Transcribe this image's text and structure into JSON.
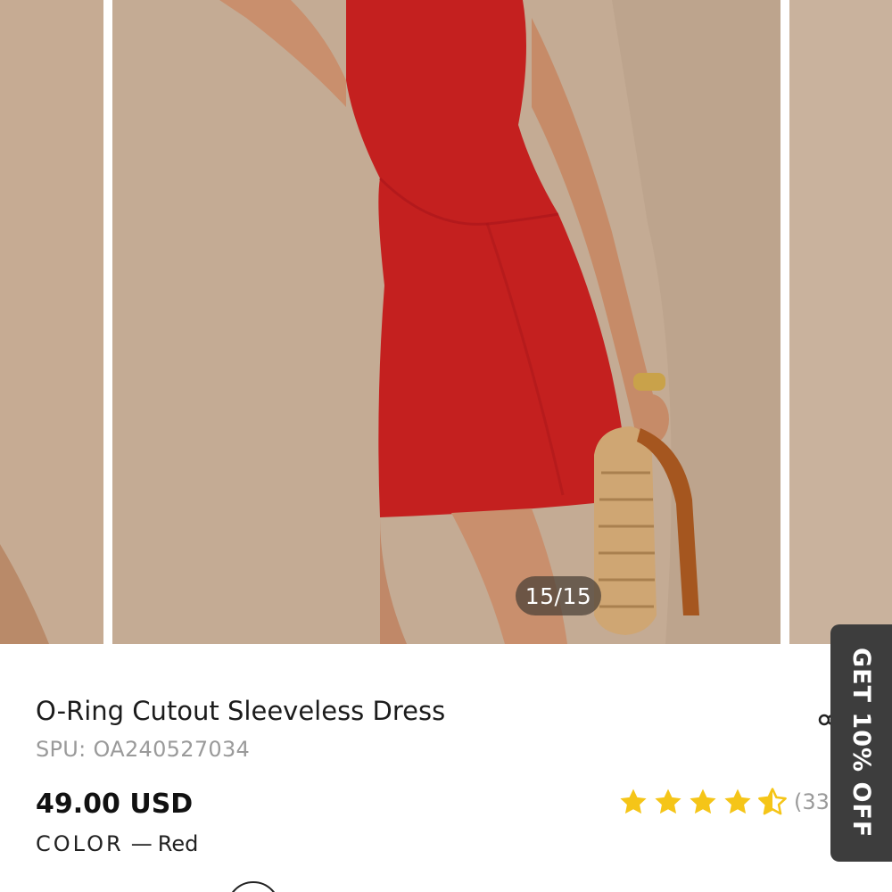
{
  "gallery": {
    "counter": "15/15",
    "image_subject": "model wearing red sleeveless dress holding woven straw bag"
  },
  "product": {
    "title": "O-Ring Cutout Sleeveless Dress",
    "spu": "SPU: OA240527034",
    "price": "49.00 USD",
    "color_label": "COLOR",
    "color_separator": "—",
    "color_value": "Red"
  },
  "rating": {
    "stars": 4.5,
    "count_text": "(33)"
  },
  "promo": {
    "label": "GET 10% OFF"
  },
  "colors": {
    "star": "#f5c518",
    "dress": "#c4201f",
    "promo_bg": "#3d3d3d"
  },
  "icons": {
    "share": "share-icon",
    "star": "star-icon"
  }
}
